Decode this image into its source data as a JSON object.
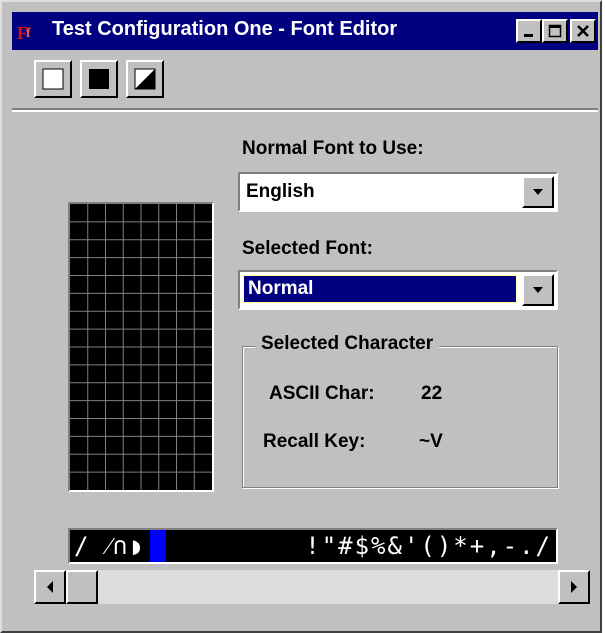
{
  "window": {
    "title": "Test Configuration One - Font Editor",
    "controls": [
      "minimize",
      "maximize",
      "close"
    ]
  },
  "toolbar": {
    "buttons": [
      {
        "name": "white-fill-button",
        "icon": "white-square-icon"
      },
      {
        "name": "black-fill-button",
        "icon": "black-square-icon"
      },
      {
        "name": "invert-button",
        "icon": "half-square-icon"
      }
    ]
  },
  "normal_font": {
    "label": "Normal Font to Use:",
    "value": "English"
  },
  "selected_font": {
    "label": "Selected Font:",
    "value": "Normal"
  },
  "selected_character": {
    "title": "Selected Character",
    "ascii_label": "ASCII Char:",
    "ascii_value": "22",
    "recall_label": "Recall Key:",
    "recall_value": "~V"
  },
  "char_strip": {
    "left_glyphs": "/ ⁄∩◗",
    "right_glyphs": "!\"#$%&'()*+,-./"
  },
  "pixel_grid": {
    "columns": 8,
    "rows": 16
  },
  "colors": {
    "title_bar": "#000080",
    "window_bg": "#c0c0c0",
    "selection": "#000080",
    "strip_highlight": "#0000ff"
  }
}
